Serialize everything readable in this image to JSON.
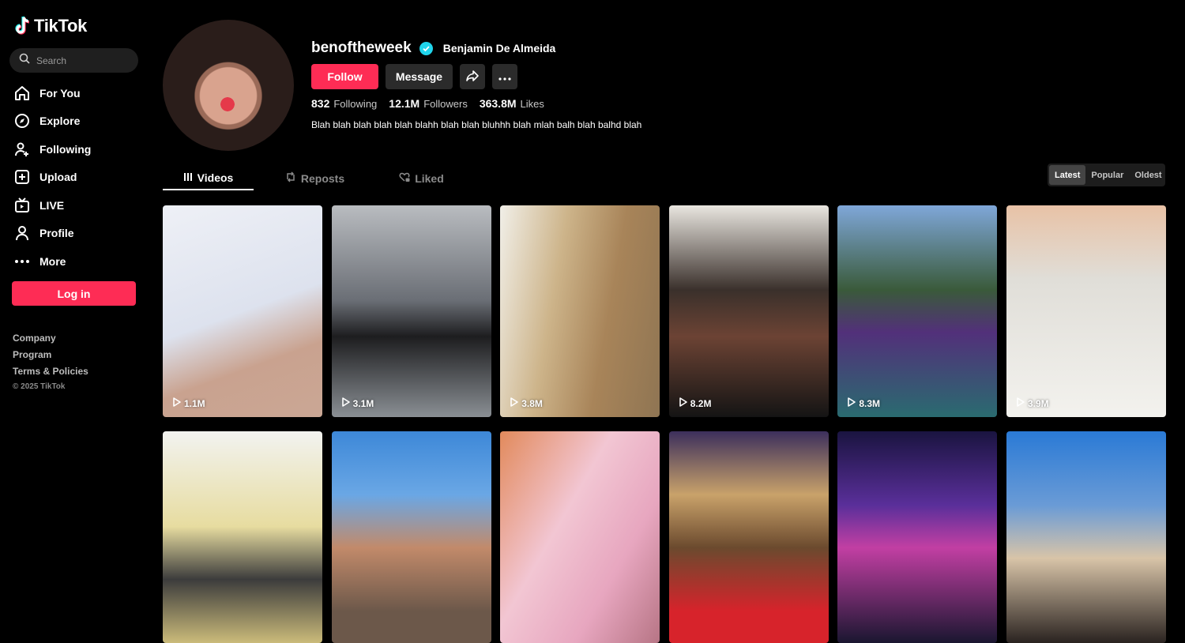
{
  "app": {
    "name": "TikTok",
    "brand_color": "#fe2c55",
    "verified_color": "#20d5ec"
  },
  "search": {
    "placeholder": "Search"
  },
  "nav": [
    {
      "label": "For You",
      "icon": "home-icon"
    },
    {
      "label": "Explore",
      "icon": "compass-icon"
    },
    {
      "label": "Following",
      "icon": "user-following-icon"
    },
    {
      "label": "Upload",
      "icon": "upload-icon"
    },
    {
      "label": "LIVE",
      "icon": "live-tv-icon"
    },
    {
      "label": "Profile",
      "icon": "person-icon"
    },
    {
      "label": "More",
      "icon": "more-dots-icon"
    }
  ],
  "login_label": "Log in",
  "footer": {
    "company": "Company",
    "program": "Program",
    "terms": "Terms & Policies",
    "copyright": "© 2025 TikTok"
  },
  "profile": {
    "username": "benoftheweek",
    "full_name": "Benjamin De Almeida",
    "follow_label": "Follow",
    "message_label": "Message",
    "stats": {
      "following": {
        "value": "832",
        "label": "Following"
      },
      "followers": {
        "value": "12.1M",
        "label": "Followers"
      },
      "likes": {
        "value": "363.8M",
        "label": "Likes"
      }
    },
    "bio": "Blah blah blah blah blah blahh blah blah bluhhh blah mlah balh blah balhd blah"
  },
  "tabs": [
    {
      "label": "Videos",
      "icon": "grid-icon",
      "active": true
    },
    {
      "label": "Reposts",
      "icon": "repost-icon",
      "active": false
    },
    {
      "label": "Liked",
      "icon": "heart-lock-icon",
      "active": false
    }
  ],
  "sort": [
    {
      "label": "Latest",
      "active": true
    },
    {
      "label": "Popular",
      "active": false
    },
    {
      "label": "Oldest",
      "active": false
    }
  ],
  "videos": [
    {
      "views": "1.1M"
    },
    {
      "views": "3.1M"
    },
    {
      "views": "3.8M"
    },
    {
      "views": "8.2M"
    },
    {
      "views": "8.3M"
    },
    {
      "views": "3.9M"
    },
    {
      "views": ""
    },
    {
      "views": ""
    },
    {
      "views": ""
    },
    {
      "views": ""
    },
    {
      "views": ""
    },
    {
      "views": ""
    }
  ]
}
